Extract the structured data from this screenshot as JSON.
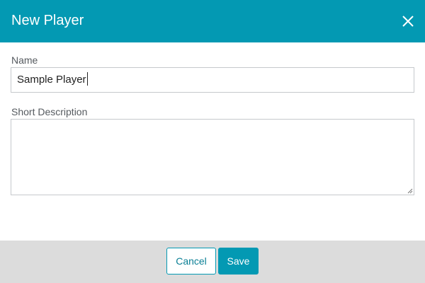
{
  "dialog": {
    "title": "New Player",
    "close_icon": "close-icon"
  },
  "form": {
    "name_label": "Name",
    "name_value": "Sample Player",
    "description_label": "Short Description",
    "description_value": ""
  },
  "footer": {
    "cancel_label": "Cancel",
    "save_label": "Save"
  },
  "colors": {
    "accent": "#0399b3",
    "footer_bg": "#dcdcdc",
    "border": "#c6c9cc"
  }
}
